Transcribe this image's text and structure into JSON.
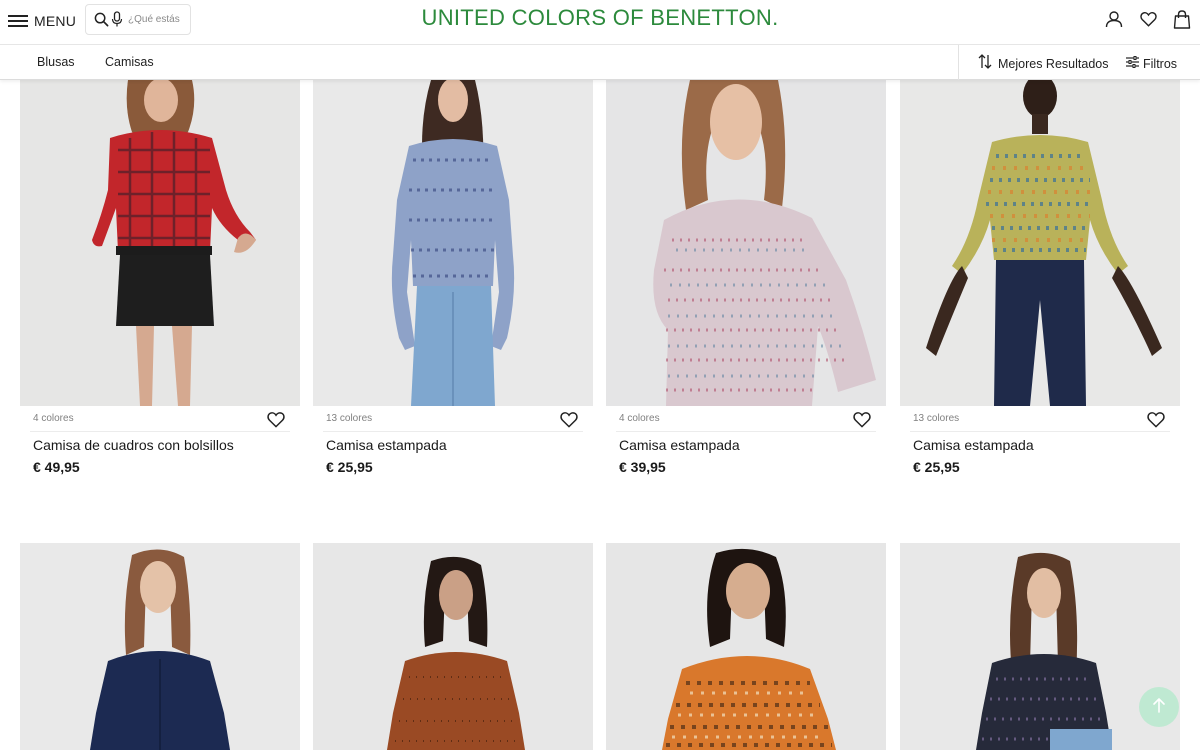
{
  "header": {
    "menu_label": "MENU",
    "search_placeholder": "¿Qué estás",
    "brand": "UNITED COLORS OF BENETTON.",
    "brand_color": "#2c8a3c",
    "icons": [
      "search-icon",
      "microphone-icon",
      "user-icon",
      "heart-icon",
      "shopping-bag-icon"
    ]
  },
  "subnav": {
    "categories": [
      "Blusas",
      "Camisas"
    ],
    "sort_label": "Mejores Resultados",
    "filter_label": "Filtros"
  },
  "products": [
    {
      "colors": "4 colores",
      "name": "Camisa de cuadros con bolsillos",
      "price": "€ 49,95"
    },
    {
      "colors": "13 colores",
      "name": "Camisa estampada",
      "price": "€ 25,95"
    },
    {
      "colors": "4 colores",
      "name": "Camisa estampada",
      "price": "€ 39,95"
    },
    {
      "colors": "13 colores",
      "name": "Camisa estampada",
      "price": "€ 25,95"
    }
  ],
  "back_to_top_color": "#bfe9d2"
}
